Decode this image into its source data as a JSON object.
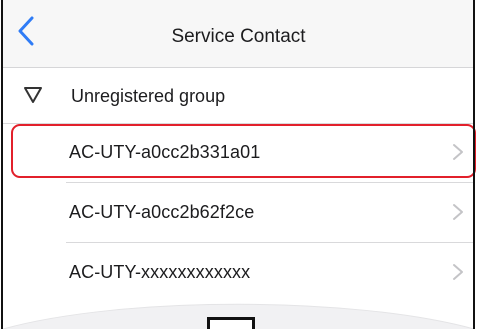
{
  "nav": {
    "title": "Service Contact",
    "back_icon": "chevron-left-icon"
  },
  "group": {
    "label": "Unregistered group",
    "icon": "triangle-down-outline-icon"
  },
  "devices": [
    {
      "label": "AC-UTY-a0cc2b331a01",
      "highlighted": true
    },
    {
      "label": "AC-UTY-a0cc2b62f2ce",
      "highlighted": false
    },
    {
      "label": "AC-UTY-xxxxxxxxxxxx",
      "highlighted": false
    }
  ],
  "colors": {
    "accent": "#2f7cf6",
    "highlight": "#e2202b",
    "chevron": "#c4c4c7",
    "separator": "#d9d9db"
  }
}
